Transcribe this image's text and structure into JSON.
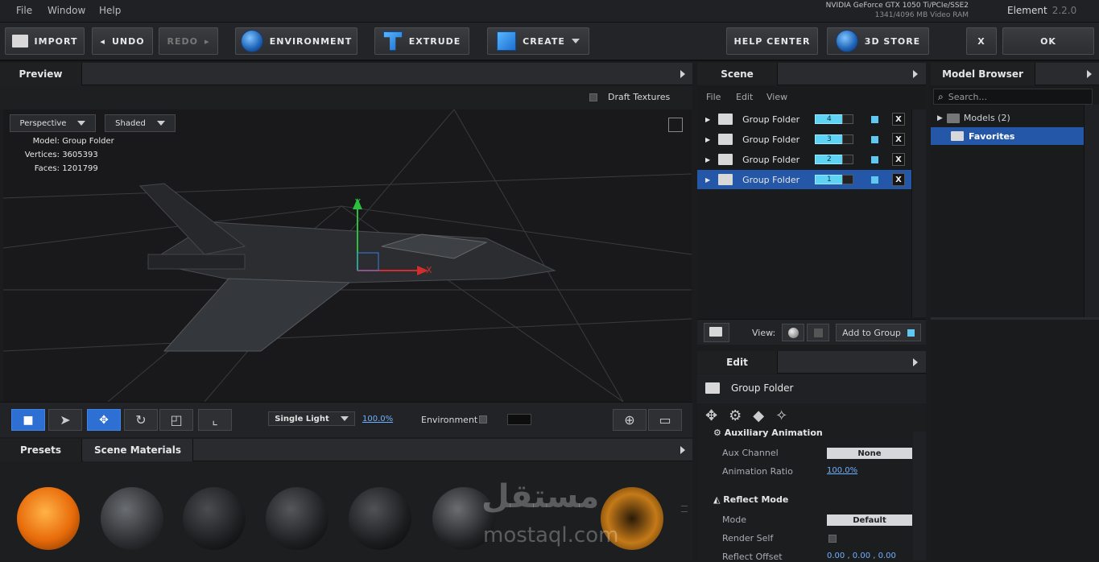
{
  "menu": [
    "File",
    "Window",
    "Help"
  ],
  "gpu": {
    "name": "NVIDIA GeForce GTX 1050 Ti/PCIe/SSE2",
    "ram": "1341/4096 MB Video RAM"
  },
  "brand": {
    "name": "Element",
    "version": "2.2.0"
  },
  "toolbar": {
    "import": "IMPORT",
    "undo": "UNDO",
    "redo": "REDO",
    "environment": "ENVIRONMENT",
    "extrude": "EXTRUDE",
    "create": "CREATE",
    "help": "HELP CENTER",
    "store": "3D STORE",
    "close": "X",
    "ok": "OK"
  },
  "preview": {
    "tab": "Preview",
    "draft_label": "Draft Textures",
    "camera": "Perspective",
    "shading": "Shaded",
    "stats": [
      {
        "k": "Model:",
        "v": "Group Folder"
      },
      {
        "k": "Vertices:",
        "v": "3605393"
      },
      {
        "k": "Faces:",
        "v": "1201799"
      }
    ],
    "axis_y": "Y",
    "axis_x": "X",
    "light": "Single Light",
    "light_pct": "100.0%",
    "env_label": "Environment"
  },
  "scene": {
    "tab": "Scene",
    "menu": [
      "File",
      "Edit",
      "View"
    ],
    "rows": [
      {
        "label": "Group Folder",
        "num": "4",
        "selected": false
      },
      {
        "label": "Group Folder",
        "num": "3",
        "selected": false
      },
      {
        "label": "Group Folder",
        "num": "2",
        "selected": false
      },
      {
        "label": "Group Folder",
        "num": "1",
        "selected": true
      }
    ],
    "view_label": "View:",
    "add_group": "Add to Group"
  },
  "edit": {
    "tab": "Edit",
    "title": "Group Folder",
    "aux_section": "Auxiliary Animation",
    "aux_channel_label": "Aux Channel",
    "aux_channel_value": "None",
    "anim_ratio_label": "Animation Ratio",
    "anim_ratio_value": "100.0%",
    "reflect_section": "Reflect Mode",
    "mode_label": "Mode",
    "mode_value": "Default",
    "render_self_label": "Render Self",
    "reflect_offset_label": "Reflect Offset",
    "reflect_offset_value": "0.00 ,  0.00 ,  0.00"
  },
  "browser": {
    "tab": "Model Browser",
    "search_placeholder": "Search...",
    "models": "Models (2)",
    "favorites": "Favorites"
  },
  "presets": {
    "tab1": "Presets",
    "tab2": "Scene Materials"
  },
  "watermark": {
    "arabic": "مستقل",
    "latin": "mostaql.com"
  },
  "colors": {
    "accent": "#2457a8",
    "cyan": "#5fd3f3",
    "link": "#6fb0ff"
  }
}
